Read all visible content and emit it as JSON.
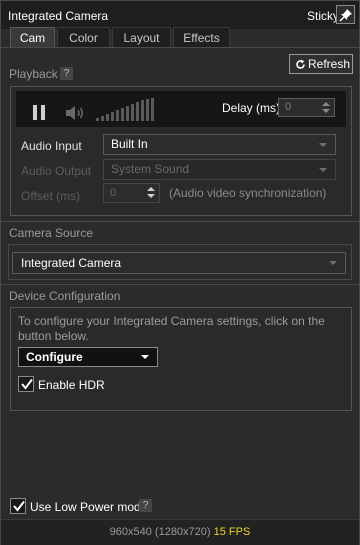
{
  "window": {
    "title": "Integrated Camera",
    "sticky_label": "Sticky"
  },
  "tabs": [
    {
      "label": "Cam",
      "active": true
    },
    {
      "label": "Color",
      "active": false
    },
    {
      "label": "Layout",
      "active": false
    },
    {
      "label": "Effects",
      "active": false
    }
  ],
  "playback": {
    "section_label": "Playback",
    "help": "?",
    "refresh_label": "Refresh",
    "delay_label": "Delay (ms)",
    "delay_value": "0",
    "volume_level_fraction": 1.0,
    "audio_input_label": "Audio Input",
    "audio_input_value": "Built In",
    "audio_output_label": "Audio Output",
    "audio_output_value": "System Sound",
    "offset_label": "Offset (ms)",
    "offset_value": "0",
    "offset_hint": "(Audio video synchronization)"
  },
  "camera_source": {
    "section_label": "Camera Source",
    "selected": "Integrated Camera"
  },
  "device_config": {
    "section_label": "Device Configuration",
    "description": "To configure your Integrated Camera settings, click on the button below.",
    "configure_label": "Configure",
    "enable_hdr_label": "Enable HDR",
    "enable_hdr_checked": true
  },
  "low_power": {
    "label": "Use Low Power mode",
    "checked": true,
    "help": "?"
  },
  "status": {
    "resolution": "960x540 (1280x720)",
    "fps": "15 FPS"
  },
  "colors": {
    "background": "#2b2b2b",
    "titlebar": "#1e1e1e",
    "fps_accent": "#e8d32c"
  }
}
